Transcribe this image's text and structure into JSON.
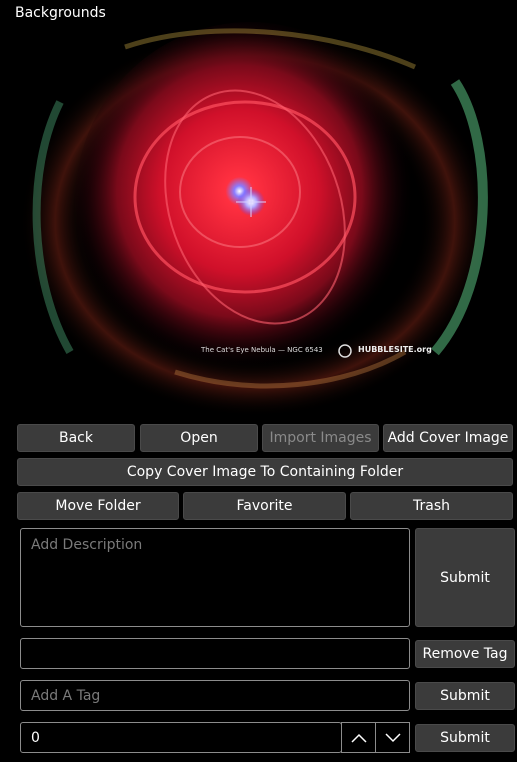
{
  "panel": {
    "title": "Backgrounds"
  },
  "image": {
    "caption": "The Cat's Eye Nebula — NGC 6543",
    "brand": "HUBBLESITE.org"
  },
  "buttons": {
    "back": "Back",
    "open": "Open",
    "import_images": "Import Images",
    "add_cover_image": "Add Cover Image",
    "copy_cover_image": "Copy Cover Image To Containing Folder",
    "move_folder": "Move Folder",
    "favorite": "Favorite",
    "trash": "Trash",
    "submit_description": "Submit",
    "remove_tag": "Remove Tag",
    "submit_tag": "Submit",
    "submit_number": "Submit"
  },
  "description": {
    "placeholder": "Add Description",
    "value": ""
  },
  "tag_display": {
    "value": ""
  },
  "add_tag": {
    "placeholder": "Add A Tag",
    "value": ""
  },
  "number": {
    "value": "0"
  },
  "icons": {
    "increment": "chevron-up-icon",
    "decrement": "chevron-down-icon"
  },
  "colors": {
    "button_bg": "#3b3b3b",
    "field_border": "#8c8c8c",
    "disabled_text": "#8a8a8a"
  }
}
